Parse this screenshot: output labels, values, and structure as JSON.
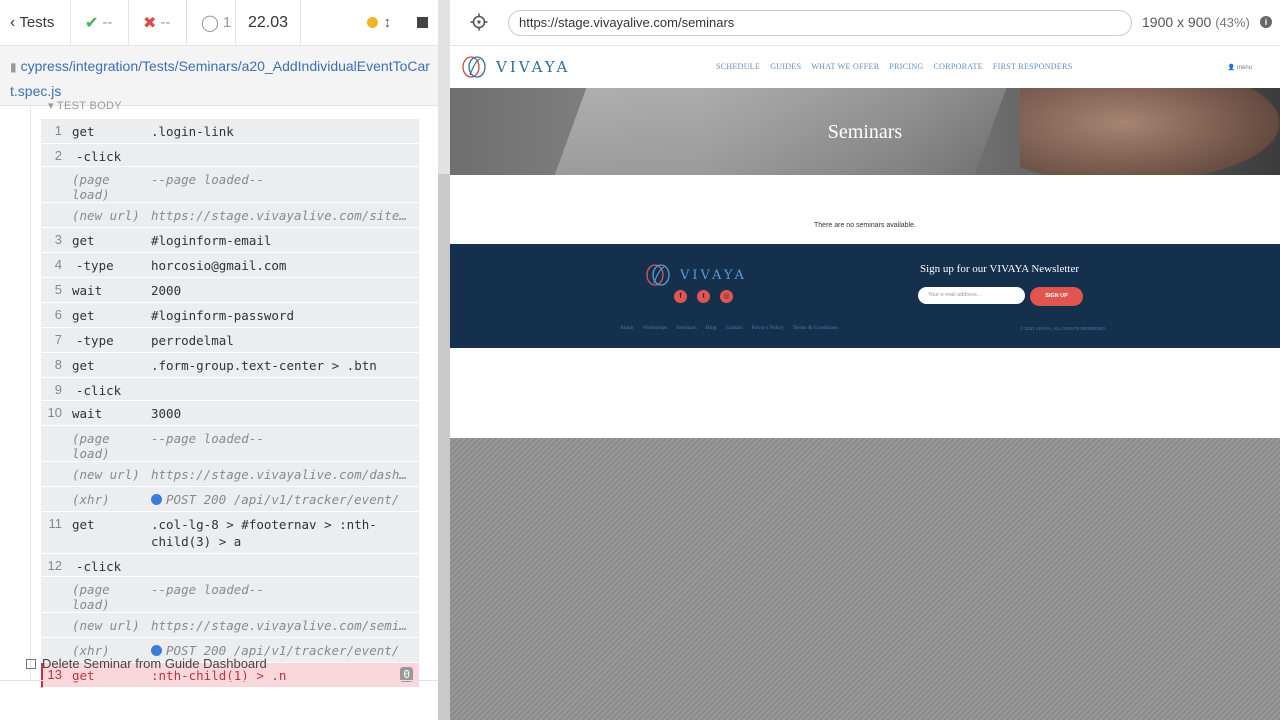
{
  "reporter": {
    "tests_button_label": "Tests",
    "passed": "--",
    "failed": "--",
    "pending": "1",
    "duration": "22.03",
    "spec_path_line1": "cypress/integration/Tests/Seminars/a20_AddIndividualEventToCar",
    "spec_path_line2": "t.spec.js",
    "test_body_label": "TEST BODY",
    "commands": [
      {
        "num": "1",
        "name": "get",
        "msg": ".login-link",
        "kind": "cmd"
      },
      {
        "num": "2",
        "name": "-click",
        "msg": "",
        "kind": "child"
      },
      {
        "num": "",
        "name": "(page load)",
        "msg": "--page loaded--",
        "kind": "event"
      },
      {
        "num": "",
        "name": "(new url)",
        "msg": "https://stage.vivayalive.com/site/login",
        "kind": "event"
      },
      {
        "num": "3",
        "name": "get",
        "msg": "#loginform-email",
        "kind": "cmd"
      },
      {
        "num": "4",
        "name": "-type",
        "msg": "horcosio@gmail.com",
        "kind": "child"
      },
      {
        "num": "5",
        "name": "wait",
        "msg": "2000",
        "kind": "cmd"
      },
      {
        "num": "6",
        "name": "get",
        "msg": "#loginform-password",
        "kind": "cmd"
      },
      {
        "num": "7",
        "name": "-type",
        "msg": "perrodelmal",
        "kind": "child"
      },
      {
        "num": "8",
        "name": "get",
        "msg": ".form-group.text-center > .btn",
        "kind": "cmd"
      },
      {
        "num": "9",
        "name": "-click",
        "msg": "",
        "kind": "child"
      },
      {
        "num": "10",
        "name": "wait",
        "msg": "3000",
        "kind": "cmd"
      },
      {
        "num": "",
        "name": "(page load)",
        "msg": "--page loaded--",
        "kind": "event"
      },
      {
        "num": "",
        "name": "(new url)",
        "msg": "https://stage.vivayalive.com/dashboard",
        "kind": "event"
      },
      {
        "num": "",
        "name": "(xhr)",
        "msg": "POST 200 /api/v1/tracker/event/",
        "kind": "xhr"
      },
      {
        "num": "11",
        "name": "get",
        "msg": ".col-lg-8 > #footernav > :nth-child(3) > a",
        "kind": "wrap"
      },
      {
        "num": "12",
        "name": "-click",
        "msg": "",
        "kind": "child"
      },
      {
        "num": "",
        "name": "(page load)",
        "msg": "--page loaded--",
        "kind": "event"
      },
      {
        "num": "",
        "name": "(new url)",
        "msg": "https://stage.vivayalive.com/seminars",
        "kind": "event"
      },
      {
        "num": "",
        "name": "(xhr)",
        "msg": "POST 200 /api/v1/tracker/event/",
        "kind": "xhr"
      },
      {
        "num": "13",
        "name": "get",
        "msg": ":nth-child(1) > .n",
        "kind": "failed",
        "badge": "0"
      }
    ],
    "next_test_label": "Delete Seminar from Guide Dashboard"
  },
  "aut": {
    "url": "https://stage.vivayalive.com/seminars",
    "viewport": "1900 x 900",
    "zoom": "(43%)",
    "site": {
      "logo": "VIVAYA",
      "nav": [
        "SCHEDULE",
        "GUIDES",
        "WHAT WE OFFER",
        "PRICING",
        "CORPORATE",
        "FIRST RESPONDERS"
      ],
      "menu": "menu",
      "hero_title": "Seminars",
      "empty_message": "There are no seminars available.",
      "footer": {
        "logo": "VIVAYA",
        "newsletter_title": "Sign up for our VIVAYA Newsletter",
        "email_placeholder": "Your e-mail address...",
        "signup_label": "SIGN UP",
        "links": [
          "About",
          "Workshops",
          "Seminars",
          "Blog",
          "Contact",
          "Privacy Policy",
          "Terms & Conditions"
        ],
        "copyright": "© 2021 VIVAYA. ALL RIGHTS RESERVED."
      }
    }
  },
  "colors": {
    "passed": "#3bb54a",
    "failed": "#e04a4a",
    "link": "#3b6fb6",
    "fail_bg": "#fbd7db",
    "footer_bg": "#14304d",
    "accent": "#e0564e"
  }
}
